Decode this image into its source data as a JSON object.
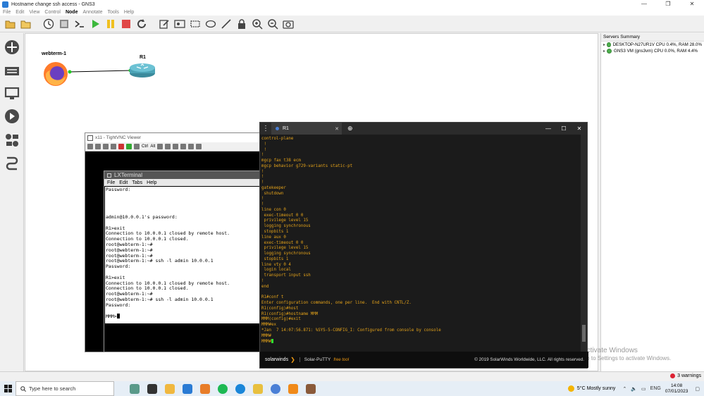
{
  "window": {
    "title": "Hostname change ssh access - GNS3",
    "controls": [
      "—",
      "❐",
      "✕"
    ]
  },
  "menu": [
    "File",
    "Edit",
    "View",
    "Control",
    "Node",
    "Annotate",
    "Tools",
    "Help"
  ],
  "menu_active": "Node",
  "toolbar": [
    "open-folder",
    "open-project",
    "snapshot",
    "preferences",
    "console",
    "start",
    "suspend",
    "stop",
    "reload",
    "note",
    "screenshot-node",
    "rectangle",
    "ellipse",
    "line",
    "lock",
    "zoom-in",
    "zoom-out",
    "camera"
  ],
  "topology": {
    "nodes": [
      {
        "label": "webterm-1"
      },
      {
        "label": "R1"
      }
    ]
  },
  "servers": {
    "header": "Servers Summary",
    "items": [
      "DESKTOP-N27UR1V CPU 0.4%, RAM 28.0%",
      "GNS3 VM (gns3vm) CPU 0.0%, RAM 4.4%"
    ]
  },
  "vnc": {
    "title": "x11 - TightVNC Viewer",
    "toolbar_text": [
      "Ctrl",
      "Alt"
    ],
    "lxterminal": {
      "title": "LXTerminal",
      "menu": [
        "File",
        "Edit",
        "Tabs",
        "Help"
      ],
      "lines": [
        "Password:",
        "",
        "",
        "",
        "",
        "admin@10.0.0.1's password:",
        "",
        "R1>exit",
        "Connection to 10.0.0.1 closed by remote host.",
        "Connection to 10.0.0.1 closed.",
        "root@webterm-1:~#",
        "root@webterm-1:~#",
        "root@webterm-1:~#",
        "root@webterm-1:~# ssh -l admin 10.0.0.1",
        "Password:",
        "",
        "R1>exit",
        "Connection to 10.0.0.1 closed by remote host.",
        "Connection to 10.0.0.1 closed.",
        "root@webterm-1:~#",
        "root@webterm-1:~# ssh -l admin 10.0.0.1",
        "Password:",
        "",
        "MMM>"
      ]
    }
  },
  "putty": {
    "tab_label": "R1",
    "window_controls": [
      "—",
      "☐",
      "✕"
    ],
    "lines": [
      "control-plane",
      " !",
      " !",
      "!",
      "mgcp fax t38 ecm",
      "mgcp behavior g729-variants static-pt",
      "!",
      "!",
      "!",
      "gatekeeper",
      " shutdown",
      "!",
      "!",
      "line con 0",
      " exec-timeout 0 0",
      " privilege level 15",
      " logging synchronous",
      " stopbits 1",
      "line aux 0",
      " exec-timeout 0 0",
      " privilege level 15",
      " logging synchronous",
      " stopbits 1",
      "line vty 0 4",
      " login local",
      " transport input ssh",
      "!",
      "end",
      "",
      "R1#conf t",
      "Enter configuration commands, one per line.  End with CNTL/Z.",
      "R1(config)#host",
      "R1(config)#hostname MMM",
      "MMM(config)#exit",
      "MMM#ex",
      "*Jan  7 14:07:56.871: %SYS-5-CONFIG_I: Configured from console by console",
      "MMM#",
      "MMM#"
    ],
    "footer": {
      "brand": "solarwinds",
      "product": "Solar-PuTTY",
      "free": "free tool",
      "copyright": "© 2019 SolarWinds Worldwide, LLC. All rights reserved."
    }
  },
  "activation": {
    "title": "Activate Windows",
    "subtitle": "Go to Settings to activate Windows."
  },
  "status": {
    "warnings": "3 warnings"
  },
  "taskbar": {
    "search_placeholder": "Type here to search",
    "weather": "5°C  Mostly sunny",
    "lang": "ENG",
    "time": "14:08",
    "date": "07/01/2023"
  },
  "colors": {
    "putty_text": "#e3a21a",
    "cursor": "#2ede2e",
    "link": "#000000",
    "server_ok": "#4cae4c"
  }
}
